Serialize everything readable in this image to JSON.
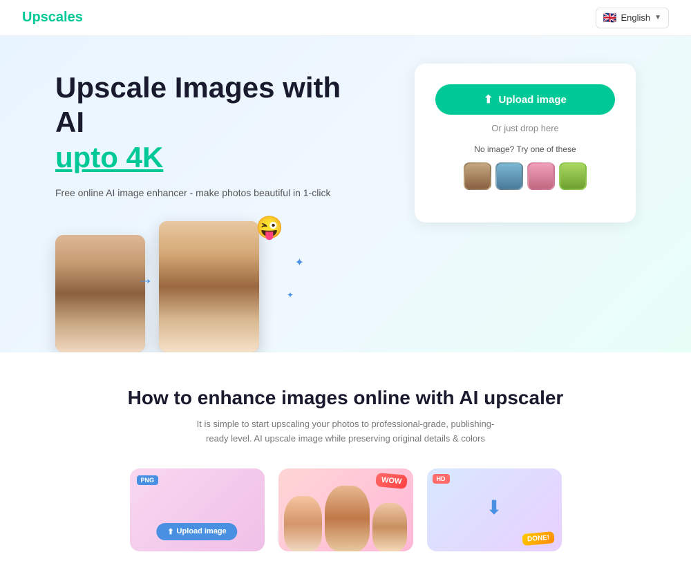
{
  "navbar": {
    "logo": "Upscales",
    "lang_flag": "🇬🇧",
    "lang_label": "English",
    "lang_chevron": "▼"
  },
  "hero": {
    "title_line1": "Upscale Images with AI",
    "title_line2_normal": "",
    "title_line2_highlight": "upto 4K",
    "subtitle": "Free online AI image enhancer - make photos beautiful in 1-click",
    "upload_button": "Upload image",
    "drop_text": "Or just drop here",
    "sample_label": "No image? Try one of these",
    "arrow": "→",
    "emoji": "😜",
    "sparkle": "✦"
  },
  "section": {
    "title": "How to enhance images online with AI upscaler",
    "subtitle": "It is simple to start upscaling your photos to professional-grade, publishing-ready level. AI upscale image while preserving original details & colors",
    "cards": [
      {
        "badge": "PNG",
        "button_label": "Upload image",
        "type": "upload"
      },
      {
        "badge": "WOW",
        "type": "enhance"
      },
      {
        "badge": "HD",
        "icon": "⬇",
        "done": "DONE!",
        "type": "download"
      }
    ]
  }
}
